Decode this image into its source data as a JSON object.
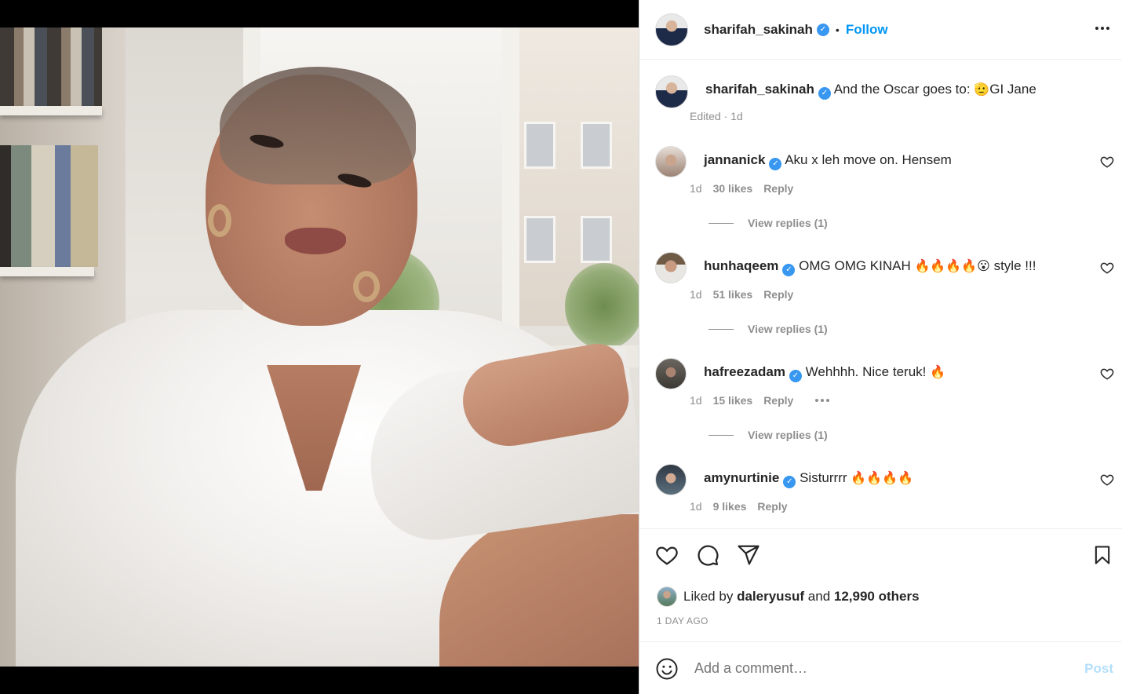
{
  "post": {
    "author": "sharifah_sakinah",
    "follow_label": "Follow",
    "dot": "•",
    "caption_text": "And the Oscar goes to: ",
    "caption_emoji": "🫡",
    "caption_tail": "GI Jane",
    "edited_label": "Edited · 1d"
  },
  "comments": [
    {
      "user": "jannanick",
      "text": "Aku x leh move on. Hensem",
      "time": "1d",
      "likes": "30 likes",
      "reply": "Reply",
      "view_replies": "View replies (1)"
    },
    {
      "user": "hunhaqeem",
      "text": "OMG OMG KINAH ",
      "emoji": "🔥🔥🔥🔥😮",
      "tail": " style !!!",
      "time": "1d",
      "likes": "51 likes",
      "reply": "Reply",
      "view_replies": "View replies (1)"
    },
    {
      "user": "hafreezadam",
      "text": "Wehhhh. Nice teruk! ",
      "emoji": "🔥",
      "time": "1d",
      "likes": "15 likes",
      "reply": "Reply",
      "view_replies": "View replies (1)"
    },
    {
      "user": "amynurtinie",
      "text": "Sisturrrr ",
      "emoji": "🔥🔥🔥🔥",
      "time": "1d",
      "likes": "9 likes",
      "reply": "Reply"
    }
  ],
  "likes": {
    "prefix": "Liked by ",
    "user": "daleryusuf",
    "mid": " and ",
    "others": "12,990 others"
  },
  "timestamp": "1 DAY AGO",
  "add_comment": {
    "placeholder": "Add a comment…",
    "post_label": "Post",
    "post_color": "#b2dffc"
  },
  "icons": {
    "like": "heart-icon",
    "comment": "comment-icon",
    "share": "share-icon",
    "save": "bookmark-icon",
    "emoji": "emoji-icon",
    "more": "more-icon",
    "verified": "verified-badge-icon"
  },
  "colors": {
    "link": "#0095f6",
    "verified": "#3897f0",
    "muted": "#8e8e8e"
  }
}
